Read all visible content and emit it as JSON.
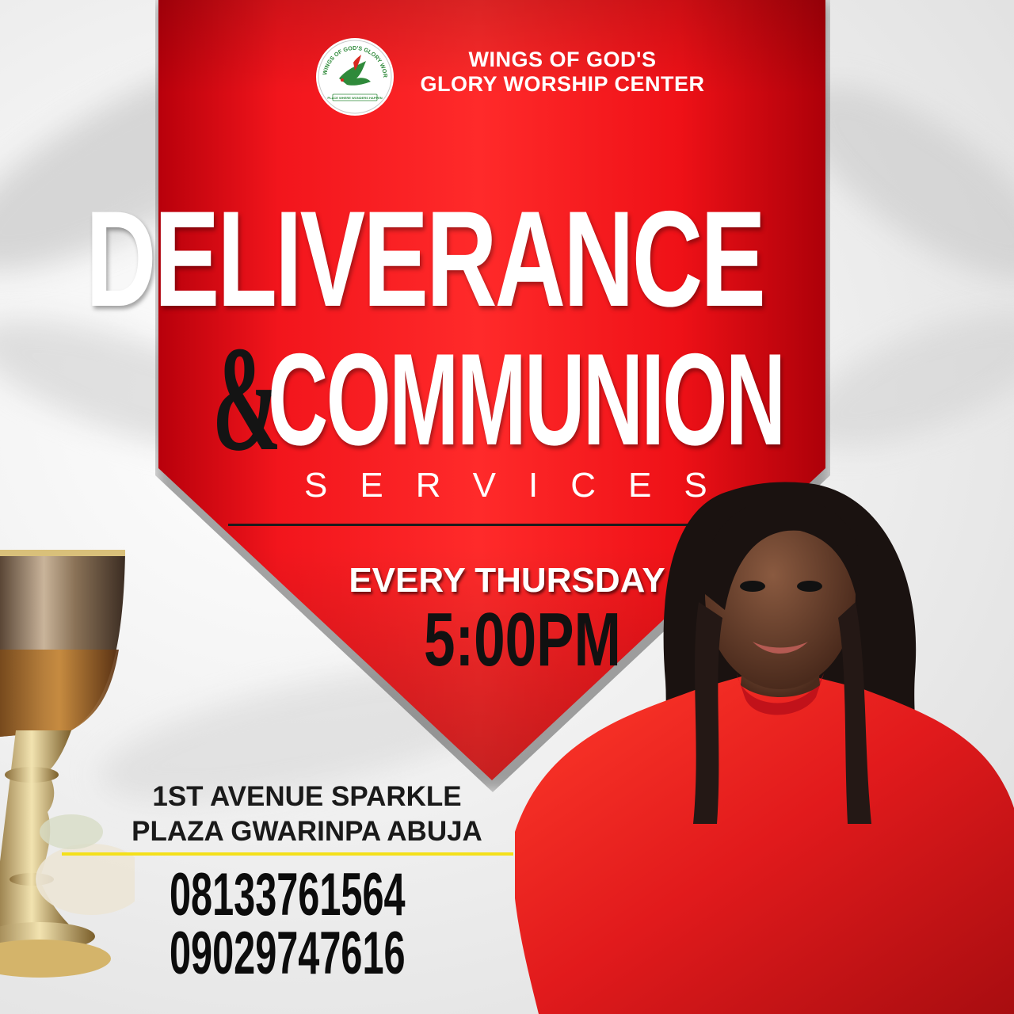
{
  "church": {
    "name_line1": "WINGS OF GOD'S",
    "name_line2": "GLORY WORSHIP CENTER"
  },
  "title": {
    "line1": "DELIVERANCE",
    "ampersand": "&",
    "line2": "COMMUNION",
    "subtitle": "SERVICES"
  },
  "schedule": {
    "day": "EVERY THURSDAY",
    "time": "5:00PM"
  },
  "address": {
    "line1": "1ST AVENUE SPARKLE",
    "line2": "PLAZA GWARINPA ABUJA"
  },
  "phones": [
    "08133761564",
    "09029747616"
  ],
  "colors": {
    "banner_red": "#f2151c",
    "divider_yellow": "#f4e01a",
    "text_dark": "#111111",
    "dress_red": "#e11a1c"
  },
  "logo": {
    "ring_text": "WINGS OF GOD'S GLORY WORSHIP CENTER",
    "tagline": "PLACE WHERE WONDERS HAPPEN",
    "icon": "dove-icon"
  }
}
